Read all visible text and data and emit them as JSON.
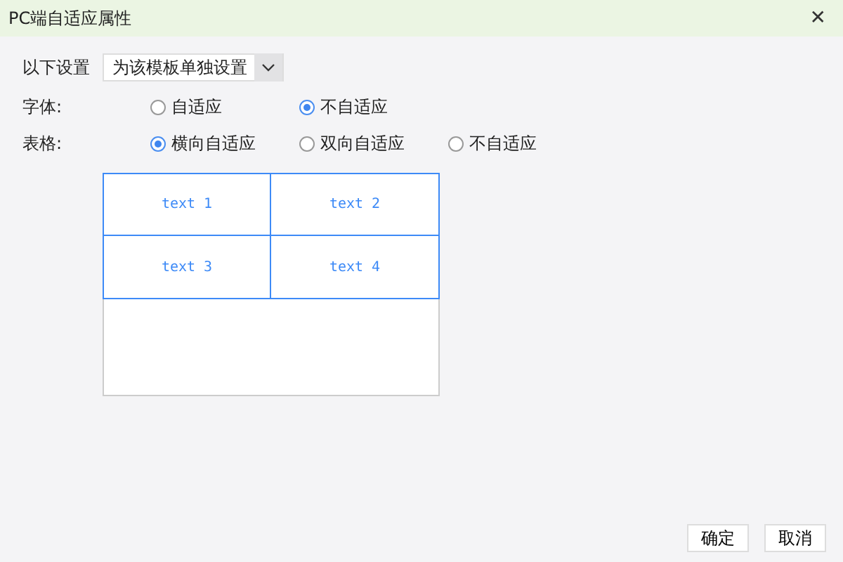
{
  "window": {
    "title": "PC端自适应属性",
    "close": "✕"
  },
  "setting": {
    "label": "以下设置",
    "value": "为该模板单独设置"
  },
  "groups": [
    {
      "label": "字体:",
      "options": [
        {
          "label": "自适应",
          "selected": false
        },
        {
          "label": "不自适应",
          "selected": true
        }
      ]
    },
    {
      "label": "表格:",
      "options": [
        {
          "label": "横向自适应",
          "selected": true
        },
        {
          "label": "双向自适应",
          "selected": false
        },
        {
          "label": "不自适应",
          "selected": false
        }
      ]
    }
  ],
  "preview": {
    "cells": [
      "text 1",
      "text 2",
      "text 3",
      "text 4"
    ]
  },
  "buttons": [
    "确定",
    "取消"
  ]
}
